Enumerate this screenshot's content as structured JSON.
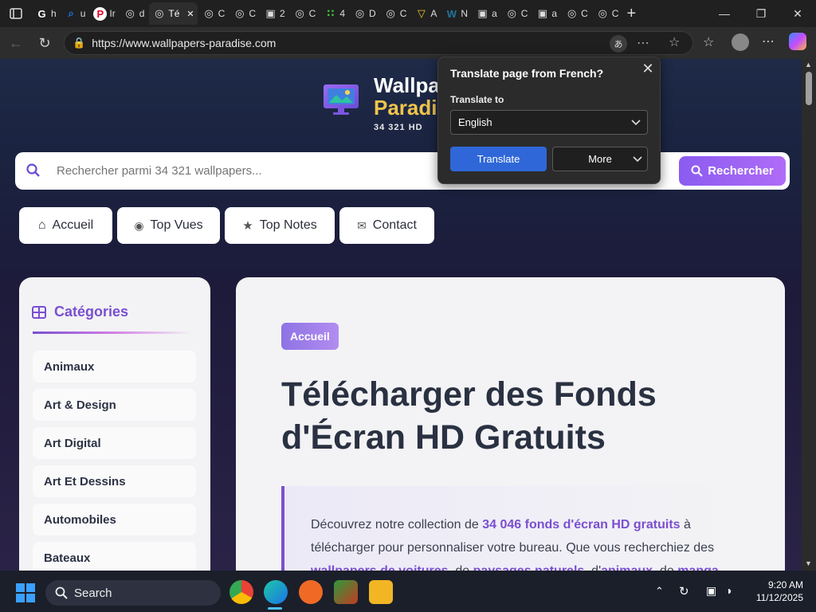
{
  "browser": {
    "active_tab_title": "Té",
    "tabs": [
      {
        "label": "h",
        "icon": "google-icon"
      },
      {
        "label": "u",
        "icon": "search-icon"
      },
      {
        "label": "Ir",
        "icon": "pinterest-icon"
      },
      {
        "label": "d",
        "icon": "globe-icon"
      },
      {
        "label": "Té",
        "icon": "globe-icon"
      },
      {
        "label": "C",
        "icon": "globe-icon"
      },
      {
        "label": "C",
        "icon": "globe-icon"
      },
      {
        "label": "2",
        "icon": "puzzle-icon"
      },
      {
        "label": "C",
        "icon": "globe-icon"
      },
      {
        "label": "4",
        "icon": "grid-icon"
      },
      {
        "label": "D",
        "icon": "globe-icon"
      },
      {
        "label": "C",
        "icon": "globe-icon"
      },
      {
        "label": "A",
        "icon": "vue-icon"
      },
      {
        "label": "N",
        "icon": "wordpress-icon"
      },
      {
        "label": "a",
        "icon": "puzzle-icon"
      },
      {
        "label": "C",
        "icon": "globe-icon"
      },
      {
        "label": "a",
        "icon": "puzzle-icon"
      },
      {
        "label": "C",
        "icon": "globe-icon"
      },
      {
        "label": "C",
        "icon": "globe-icon"
      }
    ],
    "url": "https://www.wallpapers-paradise.com"
  },
  "translate_popup": {
    "title": "Translate page from French?",
    "translate_to_label": "Translate to",
    "language": "English",
    "translate_button": "Translate",
    "more_button": "More"
  },
  "site": {
    "brand_line1": "Wallpa",
    "brand_line2": "Paradis",
    "count": "34 321 HD",
    "search_placeholder": "Rechercher parmi 34 321 wallpapers...",
    "search_button": "Rechercher",
    "nav": [
      "Accueil",
      "Top Vues",
      "Top Notes",
      "Contact"
    ],
    "categories_title": "Catégories",
    "categories": [
      "Animaux",
      "Art & Design",
      "Art Digital",
      "Art Et Dessins",
      "Automobiles",
      "Bateaux"
    ],
    "breadcrumb": "Accueil",
    "heading": "Télécharger des Fonds d'Écran HD Gratuits",
    "intro_1": "Découvrez notre collection de ",
    "intro_hl1": "34 046 fonds d'écran HD gratuits",
    "intro_2": " à télécharger pour personnaliser votre bureau. Que vous recherchiez des ",
    "intro_hl2": "wallpapers de voitures",
    "intro_3": ", de ",
    "intro_hl3": "paysages naturels",
    "intro_4": ", d'",
    "intro_hl4": "animaux",
    "intro_5": ", de ",
    "intro_hl5": "manga"
  },
  "taskbar": {
    "search_label": "Search",
    "time": "9:20 AM",
    "date": "11/12/2025"
  }
}
